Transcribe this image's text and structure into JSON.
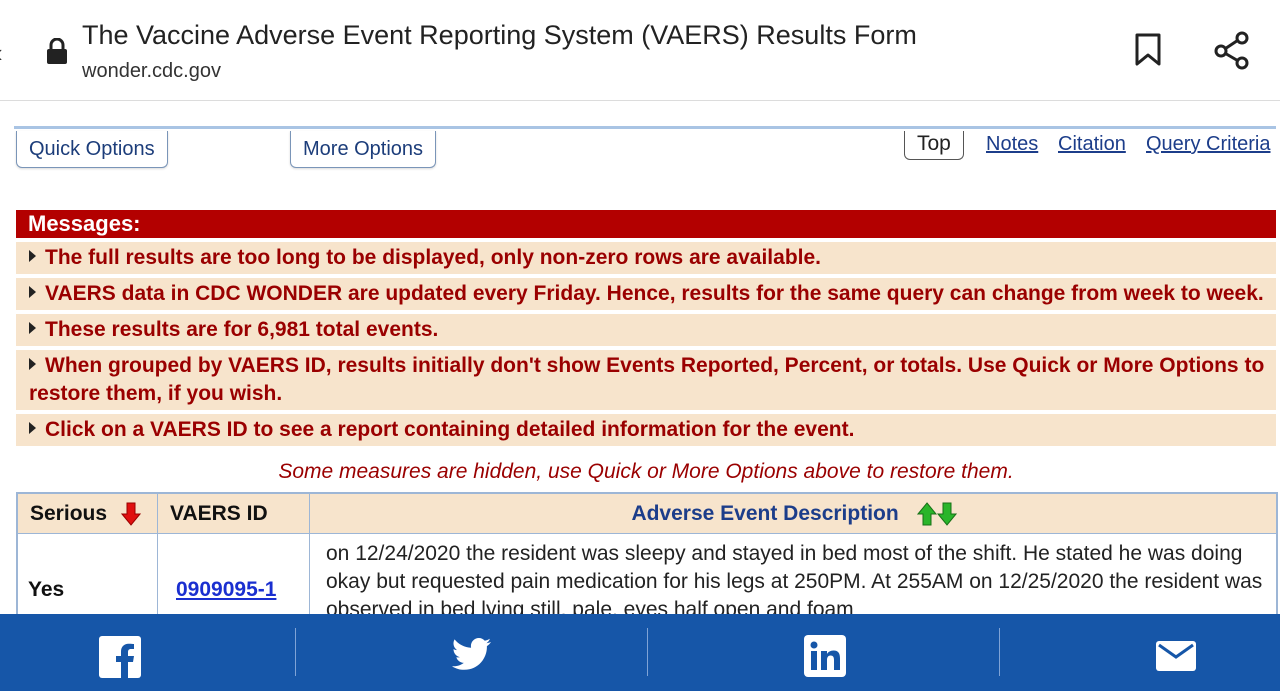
{
  "browser": {
    "page_title": "The Vaccine Adverse Event Reporting System (VAERS) Results Form",
    "url": "wonder.cdc.gov"
  },
  "options": {
    "quick": "Quick Options",
    "more": "More Options",
    "top": "Top",
    "notes": "Notes",
    "citation": "Citation",
    "query_criteria": "Query Criteria"
  },
  "messages": {
    "header": "Messages:",
    "items": [
      "The full results are too long to be displayed, only non-zero rows are available.",
      "VAERS data in CDC WONDER are updated every Friday. Hence, results for the same query can change from week to week.",
      "These results are for 6,981 total events.",
      "When grouped by VAERS ID, results initially don't show Events Reported, Percent, or totals. Use Quick or More Options to restore them, if you wish.",
      "Click on a VAERS ID to see a report containing detailed information for the event."
    ]
  },
  "hidden_note": "Some measures are hidden, use Quick or More Options above to restore them.",
  "table": {
    "headers": [
      "Serious",
      "VAERS ID",
      "Adverse Event Description"
    ],
    "rows": [
      {
        "serious": "Yes",
        "vaers_id": "0909095-1",
        "description": "on 12/24/2020 the resident was sleepy and stayed in bed most of the shift. He stated he was doing okay but requested pain medication for his legs at 250PM. At 255AM on 12/25/2020 the resident was observed in bed lying still, pale, eyes half open and foam"
      }
    ]
  },
  "colors": {
    "message_header": "#b30000",
    "message_bg": "#f7e4cc",
    "message_text": "#9a0000",
    "share_bar": "#1656a8"
  },
  "share_bar": [
    "facebook-icon",
    "twitter-icon",
    "linkedin-icon",
    "email-icon"
  ]
}
